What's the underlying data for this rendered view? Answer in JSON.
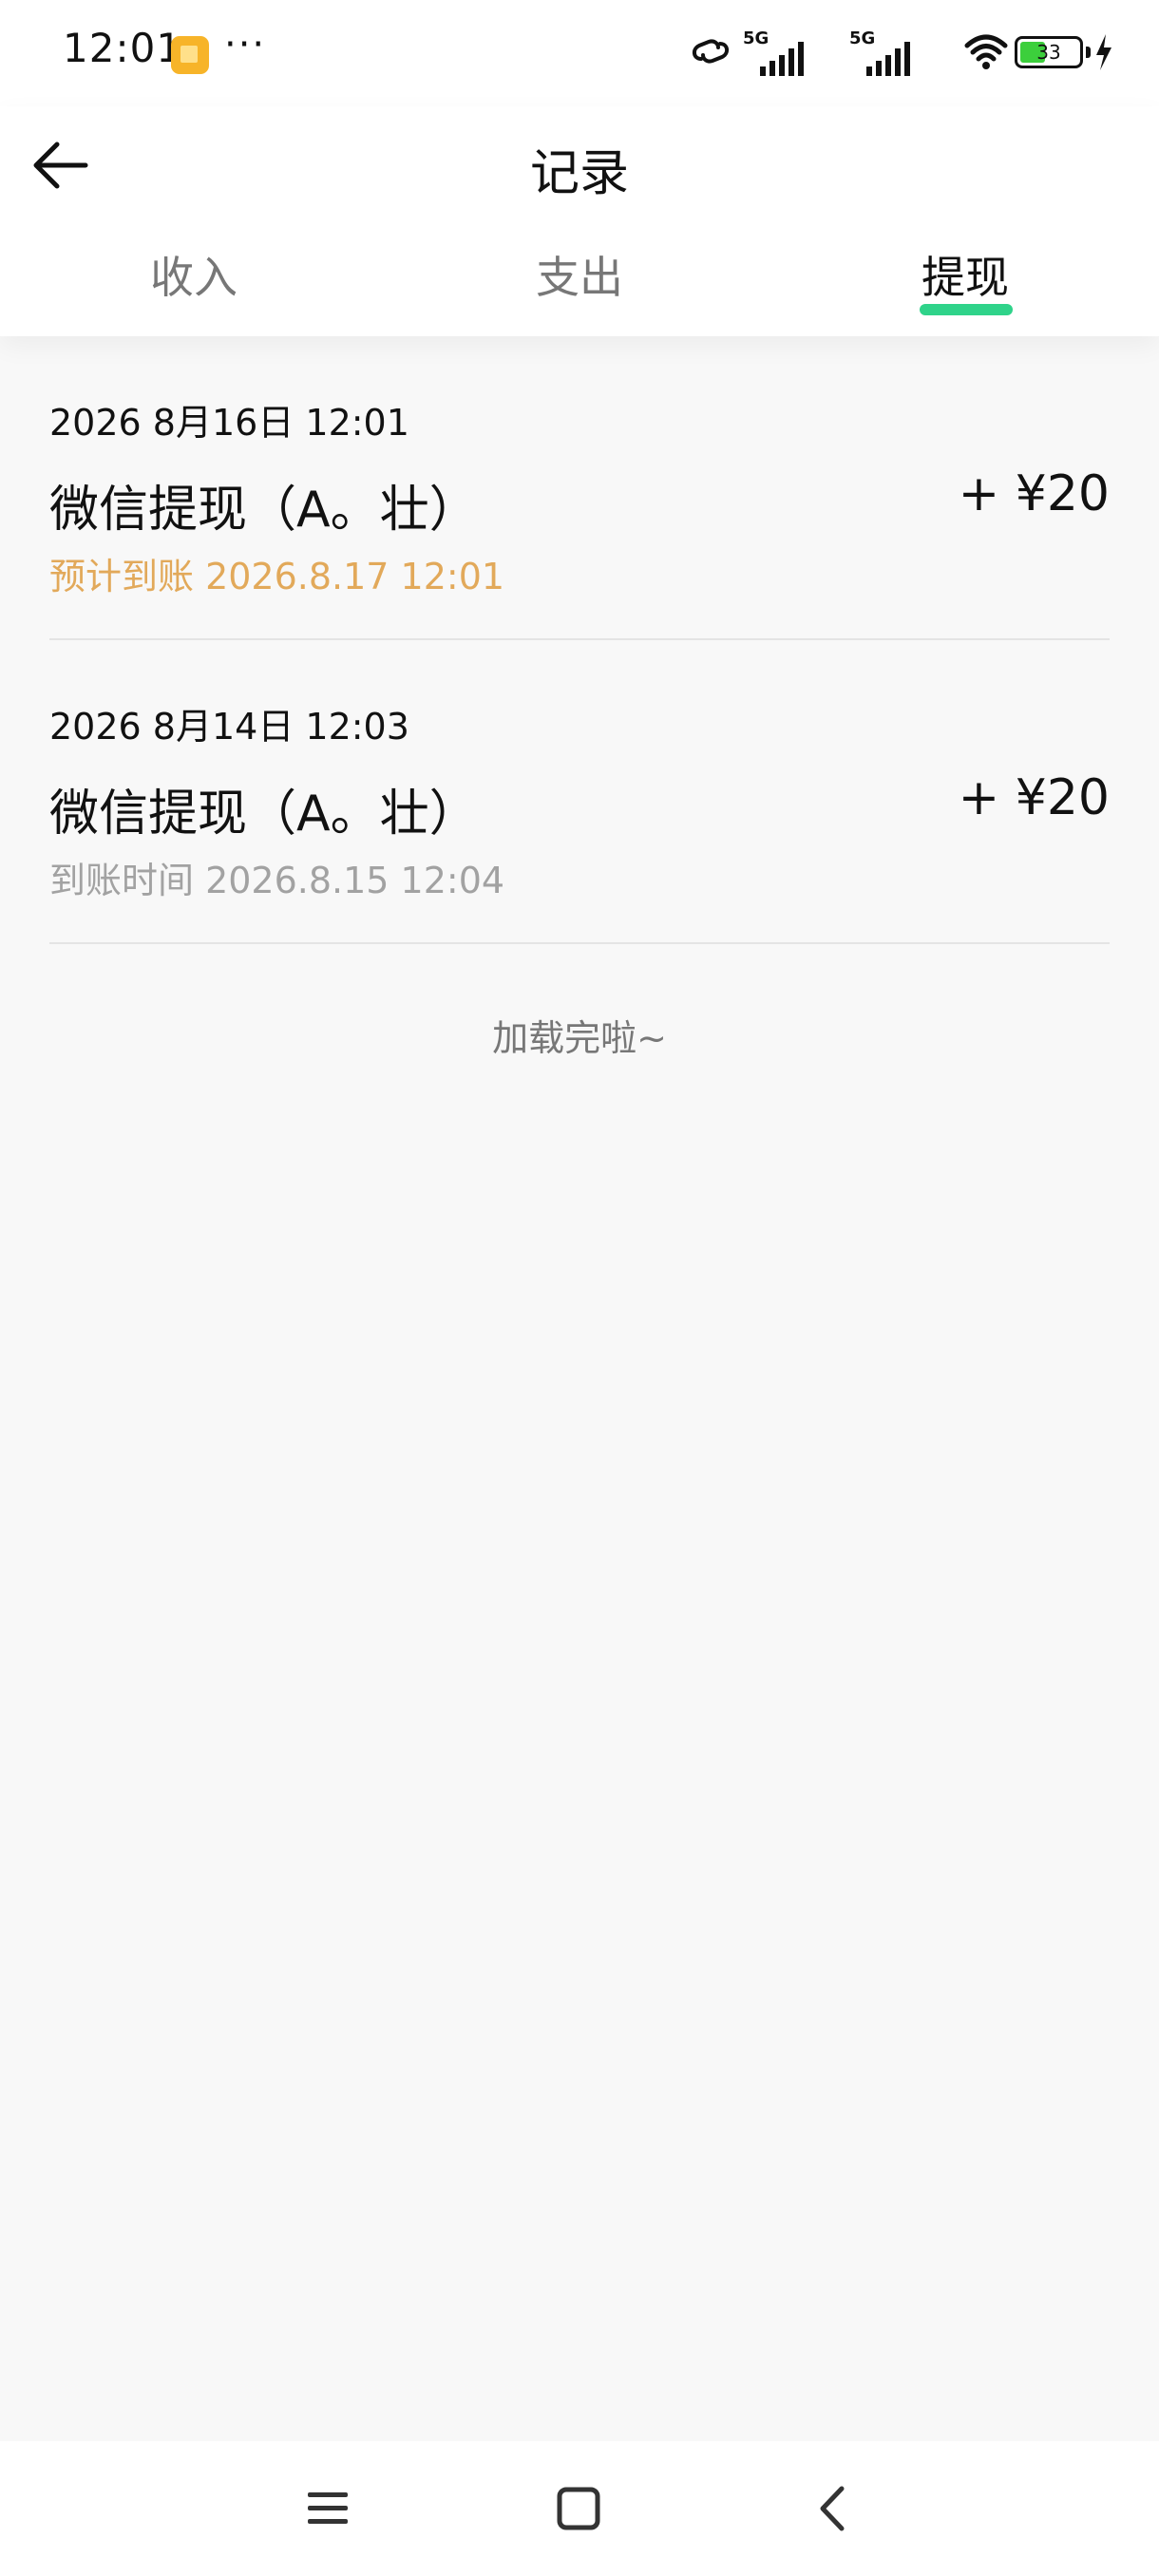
{
  "status_bar": {
    "time": "12:01",
    "more": "···",
    "network_1": "5G",
    "network_2": "5G",
    "battery": "33"
  },
  "header": {
    "title": "记录"
  },
  "tabs": [
    {
      "label": "收入",
      "active": false
    },
    {
      "label": "支出",
      "active": false
    },
    {
      "label": "提现",
      "active": true
    }
  ],
  "records": [
    {
      "date": "2026 8月16日 12:01",
      "title": "微信提现（A。壮）",
      "amount": "+ ¥20",
      "sub": "预计到账 2026.8.17 12:01",
      "status": "pending"
    },
    {
      "date": "2026 8月14日 12:03",
      "title": "微信提现（A。壮）",
      "amount": "+ ¥20",
      "sub": "到账时间 2026.8.15 12:04",
      "status": "done"
    }
  ],
  "footer_text": "加载完啦~",
  "colors": {
    "accent": "#2fd38a",
    "pending": "#e2a95a",
    "muted": "#a2a2a2",
    "background": "#f8f8f8"
  },
  "icons": [
    "back-arrow-icon",
    "menu-icon",
    "home-icon",
    "nav-back-icon",
    "wifi-icon",
    "signal-icon",
    "battery-icon",
    "charging-icon",
    "link-icon"
  ]
}
